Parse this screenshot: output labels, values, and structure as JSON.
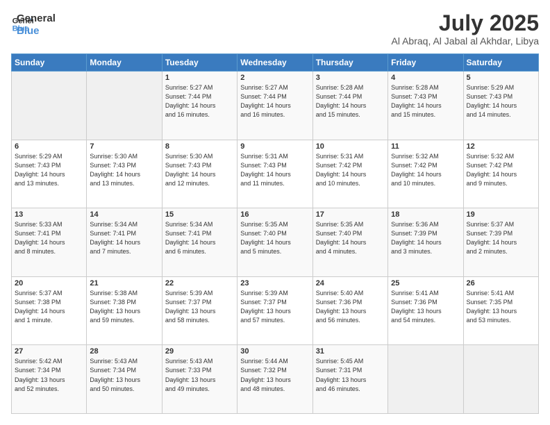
{
  "logo": {
    "line1": "General",
    "line2": "Blue"
  },
  "title": "July 2025",
  "subtitle": "Al Abraq, Al Jabal al Akhdar, Libya",
  "headers": [
    "Sunday",
    "Monday",
    "Tuesday",
    "Wednesday",
    "Thursday",
    "Friday",
    "Saturday"
  ],
  "weeks": [
    [
      {
        "day": "",
        "info": ""
      },
      {
        "day": "",
        "info": ""
      },
      {
        "day": "1",
        "info": "Sunrise: 5:27 AM\nSunset: 7:44 PM\nDaylight: 14 hours\nand 16 minutes."
      },
      {
        "day": "2",
        "info": "Sunrise: 5:27 AM\nSunset: 7:44 PM\nDaylight: 14 hours\nand 16 minutes."
      },
      {
        "day": "3",
        "info": "Sunrise: 5:28 AM\nSunset: 7:44 PM\nDaylight: 14 hours\nand 15 minutes."
      },
      {
        "day": "4",
        "info": "Sunrise: 5:28 AM\nSunset: 7:43 PM\nDaylight: 14 hours\nand 15 minutes."
      },
      {
        "day": "5",
        "info": "Sunrise: 5:29 AM\nSunset: 7:43 PM\nDaylight: 14 hours\nand 14 minutes."
      }
    ],
    [
      {
        "day": "6",
        "info": "Sunrise: 5:29 AM\nSunset: 7:43 PM\nDaylight: 14 hours\nand 13 minutes."
      },
      {
        "day": "7",
        "info": "Sunrise: 5:30 AM\nSunset: 7:43 PM\nDaylight: 14 hours\nand 13 minutes."
      },
      {
        "day": "8",
        "info": "Sunrise: 5:30 AM\nSunset: 7:43 PM\nDaylight: 14 hours\nand 12 minutes."
      },
      {
        "day": "9",
        "info": "Sunrise: 5:31 AM\nSunset: 7:43 PM\nDaylight: 14 hours\nand 11 minutes."
      },
      {
        "day": "10",
        "info": "Sunrise: 5:31 AM\nSunset: 7:42 PM\nDaylight: 14 hours\nand 10 minutes."
      },
      {
        "day": "11",
        "info": "Sunrise: 5:32 AM\nSunset: 7:42 PM\nDaylight: 14 hours\nand 10 minutes."
      },
      {
        "day": "12",
        "info": "Sunrise: 5:32 AM\nSunset: 7:42 PM\nDaylight: 14 hours\nand 9 minutes."
      }
    ],
    [
      {
        "day": "13",
        "info": "Sunrise: 5:33 AM\nSunset: 7:41 PM\nDaylight: 14 hours\nand 8 minutes."
      },
      {
        "day": "14",
        "info": "Sunrise: 5:34 AM\nSunset: 7:41 PM\nDaylight: 14 hours\nand 7 minutes."
      },
      {
        "day": "15",
        "info": "Sunrise: 5:34 AM\nSunset: 7:41 PM\nDaylight: 14 hours\nand 6 minutes."
      },
      {
        "day": "16",
        "info": "Sunrise: 5:35 AM\nSunset: 7:40 PM\nDaylight: 14 hours\nand 5 minutes."
      },
      {
        "day": "17",
        "info": "Sunrise: 5:35 AM\nSunset: 7:40 PM\nDaylight: 14 hours\nand 4 minutes."
      },
      {
        "day": "18",
        "info": "Sunrise: 5:36 AM\nSunset: 7:39 PM\nDaylight: 14 hours\nand 3 minutes."
      },
      {
        "day": "19",
        "info": "Sunrise: 5:37 AM\nSunset: 7:39 PM\nDaylight: 14 hours\nand 2 minutes."
      }
    ],
    [
      {
        "day": "20",
        "info": "Sunrise: 5:37 AM\nSunset: 7:38 PM\nDaylight: 14 hours\nand 1 minute."
      },
      {
        "day": "21",
        "info": "Sunrise: 5:38 AM\nSunset: 7:38 PM\nDaylight: 13 hours\nand 59 minutes."
      },
      {
        "day": "22",
        "info": "Sunrise: 5:39 AM\nSunset: 7:37 PM\nDaylight: 13 hours\nand 58 minutes."
      },
      {
        "day": "23",
        "info": "Sunrise: 5:39 AM\nSunset: 7:37 PM\nDaylight: 13 hours\nand 57 minutes."
      },
      {
        "day": "24",
        "info": "Sunrise: 5:40 AM\nSunset: 7:36 PM\nDaylight: 13 hours\nand 56 minutes."
      },
      {
        "day": "25",
        "info": "Sunrise: 5:41 AM\nSunset: 7:36 PM\nDaylight: 13 hours\nand 54 minutes."
      },
      {
        "day": "26",
        "info": "Sunrise: 5:41 AM\nSunset: 7:35 PM\nDaylight: 13 hours\nand 53 minutes."
      }
    ],
    [
      {
        "day": "27",
        "info": "Sunrise: 5:42 AM\nSunset: 7:34 PM\nDaylight: 13 hours\nand 52 minutes."
      },
      {
        "day": "28",
        "info": "Sunrise: 5:43 AM\nSunset: 7:34 PM\nDaylight: 13 hours\nand 50 minutes."
      },
      {
        "day": "29",
        "info": "Sunrise: 5:43 AM\nSunset: 7:33 PM\nDaylight: 13 hours\nand 49 minutes."
      },
      {
        "day": "30",
        "info": "Sunrise: 5:44 AM\nSunset: 7:32 PM\nDaylight: 13 hours\nand 48 minutes."
      },
      {
        "day": "31",
        "info": "Sunrise: 5:45 AM\nSunset: 7:31 PM\nDaylight: 13 hours\nand 46 minutes."
      },
      {
        "day": "",
        "info": ""
      },
      {
        "day": "",
        "info": ""
      }
    ]
  ]
}
